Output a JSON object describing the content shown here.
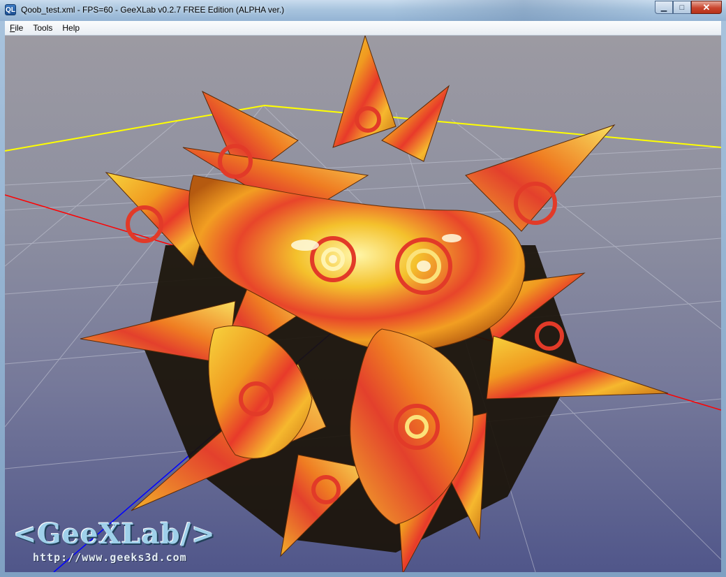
{
  "window": {
    "title": "Qoob_test.xml - FPS=60 - GeeXLab v0.2.7 FREE Edition (ALPHA ver.)",
    "app_icon_text": "QL",
    "minimize_glyph": "▁",
    "maximize_glyph": "□",
    "close_glyph": "✕"
  },
  "menu": {
    "items": [
      {
        "accel": "F",
        "rest": "ile"
      },
      {
        "accel": "",
        "rest": "Tools"
      },
      {
        "accel": "",
        "rest": "Help"
      }
    ]
  },
  "viewport": {
    "logo": "<GeeXLab/>",
    "url": "http://www.geeks3d.com",
    "colors": {
      "x_axis": "#ff0000",
      "y_axis": "#0000ff",
      "bounding_square": "#ffff00",
      "grid": "#c8cbd8",
      "object_orange": "#f0a020",
      "object_red": "#e03a28",
      "object_yellow": "#f5d23c"
    }
  }
}
